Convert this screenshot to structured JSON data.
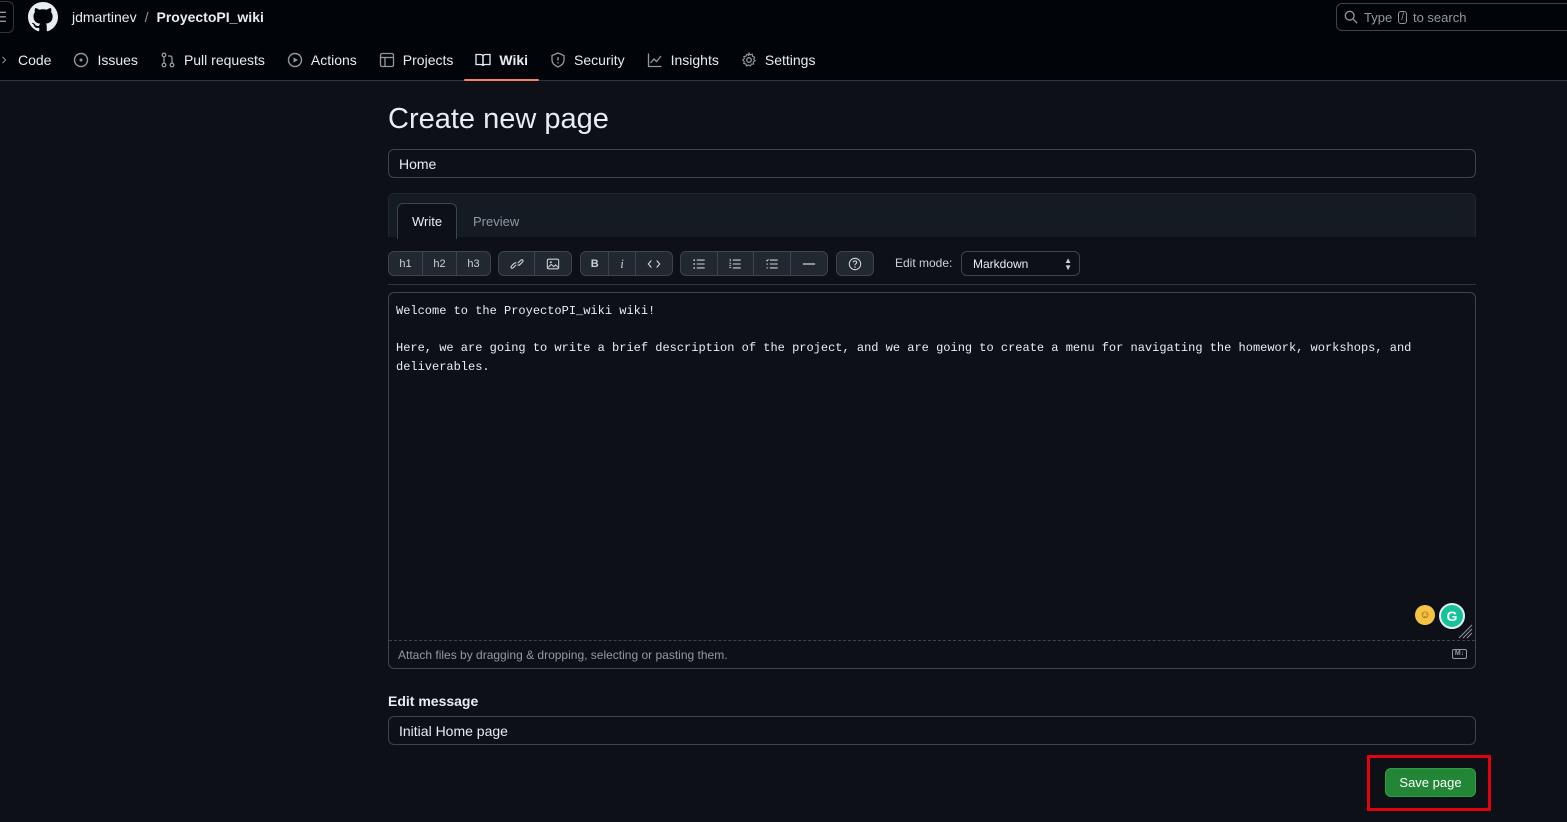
{
  "header": {
    "owner": "jdmartinev",
    "separator": "/",
    "repo": "ProyectoPI_wiki",
    "search_prefix": "Type",
    "search_key": "/",
    "search_suffix": "to search"
  },
  "nav": [
    {
      "label": "Code",
      "icon": "code-icon"
    },
    {
      "label": "Issues",
      "icon": "issues-icon"
    },
    {
      "label": "Pull requests",
      "icon": "pull-request-icon"
    },
    {
      "label": "Actions",
      "icon": "actions-icon"
    },
    {
      "label": "Projects",
      "icon": "projects-icon"
    },
    {
      "label": "Wiki",
      "icon": "book-icon",
      "active": true
    },
    {
      "label": "Security",
      "icon": "shield-icon"
    },
    {
      "label": "Insights",
      "icon": "graph-icon"
    },
    {
      "label": "Settings",
      "icon": "gear-icon"
    }
  ],
  "main": {
    "title": "Create new page",
    "page_title_value": "Home",
    "tabs": {
      "write": "Write",
      "preview": "Preview"
    },
    "toolbar": {
      "headings": [
        "h1",
        "h2",
        "h3"
      ],
      "bold": "B",
      "italic": "i",
      "edit_mode_label": "Edit mode:",
      "edit_mode_value": "Markdown"
    },
    "content": "Welcome to the ProyectoPI_wiki wiki!\n\nHere, we are going to write a brief description of the project, and we are going to create a menu for navigating the homework, workshops, and deliverables.",
    "attach_hint": "Attach files by dragging & dropping, selecting or pasting them.",
    "edit_message_label": "Edit message",
    "edit_message_value": "Initial Home page",
    "save_label": "Save page"
  },
  "colors": {
    "background": "#0d1117",
    "header": "#010409",
    "accent_underline": "#f78166",
    "save_button": "#238636",
    "highlight": "#e3000f"
  }
}
